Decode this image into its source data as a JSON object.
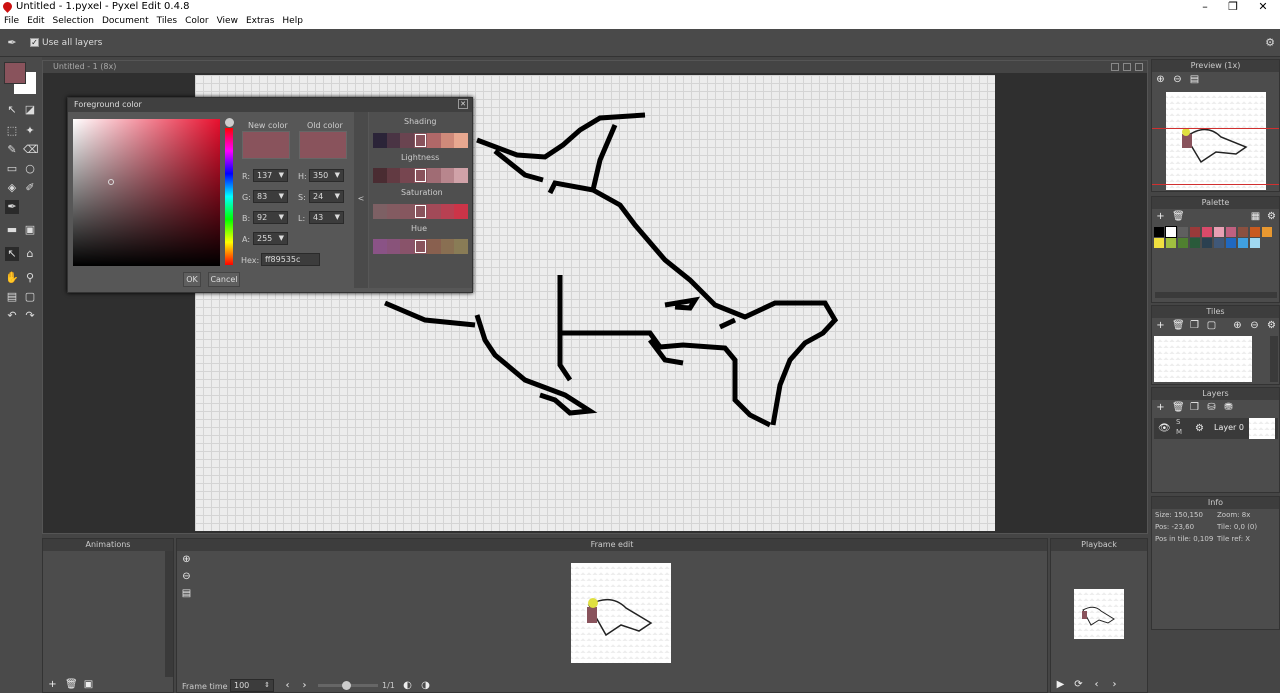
{
  "window": {
    "title": "Untitled - 1.pyxel - Pyxel Edit 0.4.8",
    "minimize": "–",
    "maximize": "❐",
    "close": "✕"
  },
  "menu": [
    "File",
    "Edit",
    "Selection",
    "Document",
    "Tiles",
    "Color",
    "View",
    "Extras",
    "Help"
  ],
  "tool_options": {
    "use_all_layers": "Use all layers",
    "check": "✓"
  },
  "document": {
    "tab": "Untitled - 1  (8x)"
  },
  "dialog": {
    "title": "Foreground color",
    "close": "✕",
    "new_color_label": "New color",
    "old_color_label": "Old color",
    "rgb": [
      {
        "label": "R:",
        "value": "137"
      },
      {
        "label": "G:",
        "value": "83"
      },
      {
        "label": "B:",
        "value": "92"
      }
    ],
    "hsl": [
      {
        "label": "H:",
        "value": "350"
      },
      {
        "label": "S:",
        "value": "24"
      },
      {
        "label": "L:",
        "value": "43"
      }
    ],
    "alpha": {
      "label": "A:",
      "value": "255"
    },
    "hex": {
      "label": "Hex:",
      "value": "ff89535c"
    },
    "ok": "OK",
    "cancel": "Cancel",
    "collapse": "<",
    "shading_label": "Shading",
    "lightness_label": "Lightness",
    "saturation_label": "Saturation",
    "hue_label": "Hue",
    "current_color": "#89535c",
    "shading": [
      "#2b2438",
      "#4a3444",
      "#6a4450",
      "#89535c",
      "#b06868",
      "#cf8a7a",
      "#e8a890"
    ],
    "lightness": [
      "#4a2c32",
      "#623a42",
      "#774650",
      "#89535c",
      "#a06c74",
      "#b8868d",
      "#d0a2a8"
    ],
    "saturation": [
      "#7d6064",
      "#835b61",
      "#86575f",
      "#89535c",
      "#a24a58",
      "#b84052",
      "#cc3448"
    ],
    "hue": [
      "#8a5386",
      "#89537a",
      "#89536a",
      "#89535c",
      "#89604f",
      "#896f52",
      "#897c56"
    ]
  },
  "preview": {
    "title": "Preview (1x)"
  },
  "palette": {
    "title": "Palette",
    "row1": [
      "#000000",
      "#ffffff",
      "#5f5f5f",
      "#9a3a3a",
      "#d84a6a",
      "#e8a0b4",
      "#c06080",
      "#8a5040",
      "#c85a20",
      "#e89830"
    ],
    "row2": [
      "#f0e040",
      "#a0c040",
      "#508030",
      "#2a5a3a",
      "#2a4050",
      "#405878",
      "#2068c0",
      "#40a0e0",
      "#a0d8f0"
    ]
  },
  "tiles": {
    "title": "Tiles"
  },
  "layers": {
    "title": "Layers",
    "layer_name": "Layer 0",
    "s": "S",
    "m": "M"
  },
  "info": {
    "title": "Info",
    "size": "Size: 150,150",
    "zoom": "Zoom: 8x",
    "pos": "Pos: -23,60",
    "tile": "Tile: 0,0 (0)",
    "pos_in_tile": "Pos in tile: 0,109",
    "tile_ref": "Tile ref: X"
  },
  "animations": {
    "title": "Animations"
  },
  "frame_edit": {
    "title": "Frame edit",
    "frame_time_label": "Frame time",
    "frame_time_value": "100",
    "frame_count": "1/1"
  },
  "playback": {
    "title": "Playback"
  },
  "colors": {
    "fg": "#89535c",
    "bg": "#ffffff"
  }
}
